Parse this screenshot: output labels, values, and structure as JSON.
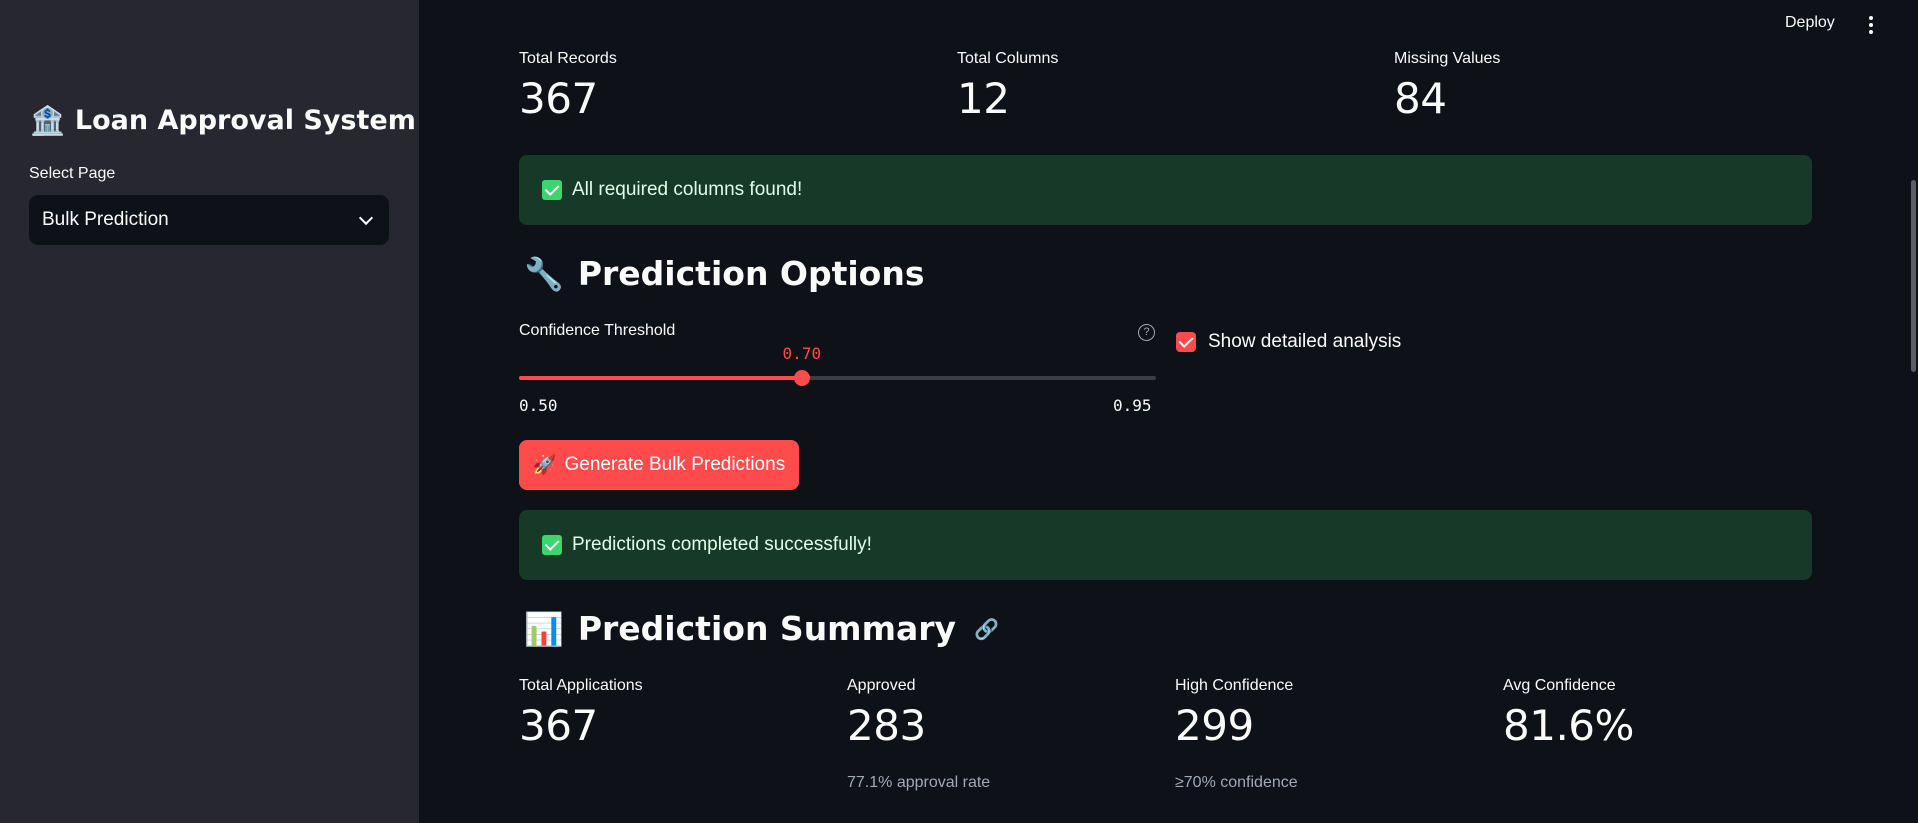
{
  "sidebar": {
    "title_icon": "🏦",
    "title": "Loan Approval System",
    "select_label": "Select Page",
    "select_value": "Bulk Prediction"
  },
  "header": {
    "deploy_label": "Deploy",
    "menu_icon": "kebab-menu-icon"
  },
  "dataset_metrics": [
    {
      "label": "Total Records",
      "value": "367"
    },
    {
      "label": "Total Columns",
      "value": "12"
    },
    {
      "label": "Missing Values",
      "value": "84"
    }
  ],
  "alerts": {
    "columns_found": "All required columns found!",
    "predictions_done": "Predictions completed successfully!"
  },
  "prediction_options": {
    "icon": "🔧",
    "title": "Prediction Options",
    "slider": {
      "label": "Confidence Threshold",
      "value": "0.70",
      "min": "0.50",
      "max": "0.95",
      "fraction": 0.444
    },
    "show_detailed_label": "Show detailed analysis",
    "show_detailed_checked": true,
    "generate_button_icon": "🚀",
    "generate_button_label": "Generate Bulk Predictions"
  },
  "summary": {
    "icon": "📊",
    "title": "Prediction Summary",
    "metrics": [
      {
        "label": "Total Applications",
        "value": "367",
        "delta": ""
      },
      {
        "label": "Approved",
        "value": "283",
        "delta": "77.1% approval rate"
      },
      {
        "label": "High Confidence",
        "value": "299",
        "delta": "≥70% confidence"
      },
      {
        "label": "Avg Confidence",
        "value": "81.6%",
        "delta": ""
      }
    ]
  },
  "colors": {
    "accent": "#ff4b4b",
    "success_bg": "#173928",
    "success_text": "#dffde9",
    "sidebar_bg": "#262730",
    "main_bg": "#0e1117"
  }
}
